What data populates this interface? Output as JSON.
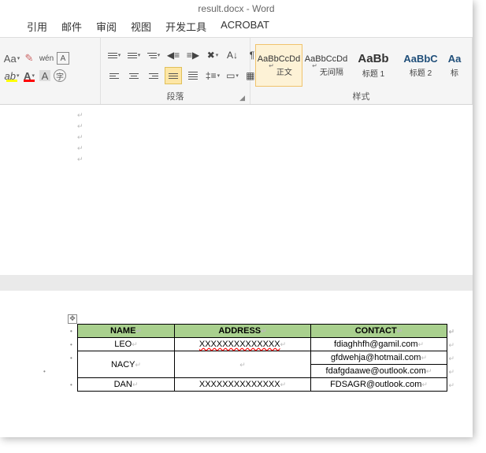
{
  "window_title": "result.docx - Word",
  "tabs": [
    "引用",
    "邮件",
    "审阅",
    "视图",
    "开发工具",
    "ACROBAT"
  ],
  "ribbon": {
    "font_label": "Aa",
    "highlight_color": "#ffff00",
    "font_color": "#ff0000",
    "para_group_label": "段落",
    "styles_group_label": "样式",
    "styles": [
      {
        "preview": "AaBbCcDd",
        "label": "正文",
        "cls": "",
        "corner": "↵"
      },
      {
        "preview": "AaBbCcDd",
        "label": "无间隔",
        "cls": "",
        "corner": "↵"
      },
      {
        "preview": "AaBb",
        "label": "标题 1",
        "cls": "big",
        "corner": ""
      },
      {
        "preview": "AaBbC",
        "label": "标题 2",
        "cls": "med",
        "corner": ""
      },
      {
        "preview": "Aa",
        "label": "标",
        "cls": "med",
        "corner": ""
      }
    ]
  },
  "table": {
    "headers": [
      "NAME",
      "ADDRESS",
      "CONTACT"
    ],
    "rows": [
      {
        "name": "LEO",
        "rowspan": 1,
        "addr": "XXXXXXXXXXXXXX",
        "addr_err": true,
        "contact": "fdiaghhfh@gamil.com"
      },
      {
        "name": "NACY",
        "rowspan": 2,
        "addr": "",
        "contact": "gfdwehja@hotmail.com"
      },
      {
        "name": "",
        "rowspan": 0,
        "addr": "",
        "contact": "fdafgdaawe@outlook.com"
      },
      {
        "name": "DAN",
        "rowspan": 1,
        "addr": "XXXXXXXXXXXXXX",
        "contact": "FDSAGR@outlook.com"
      }
    ]
  }
}
